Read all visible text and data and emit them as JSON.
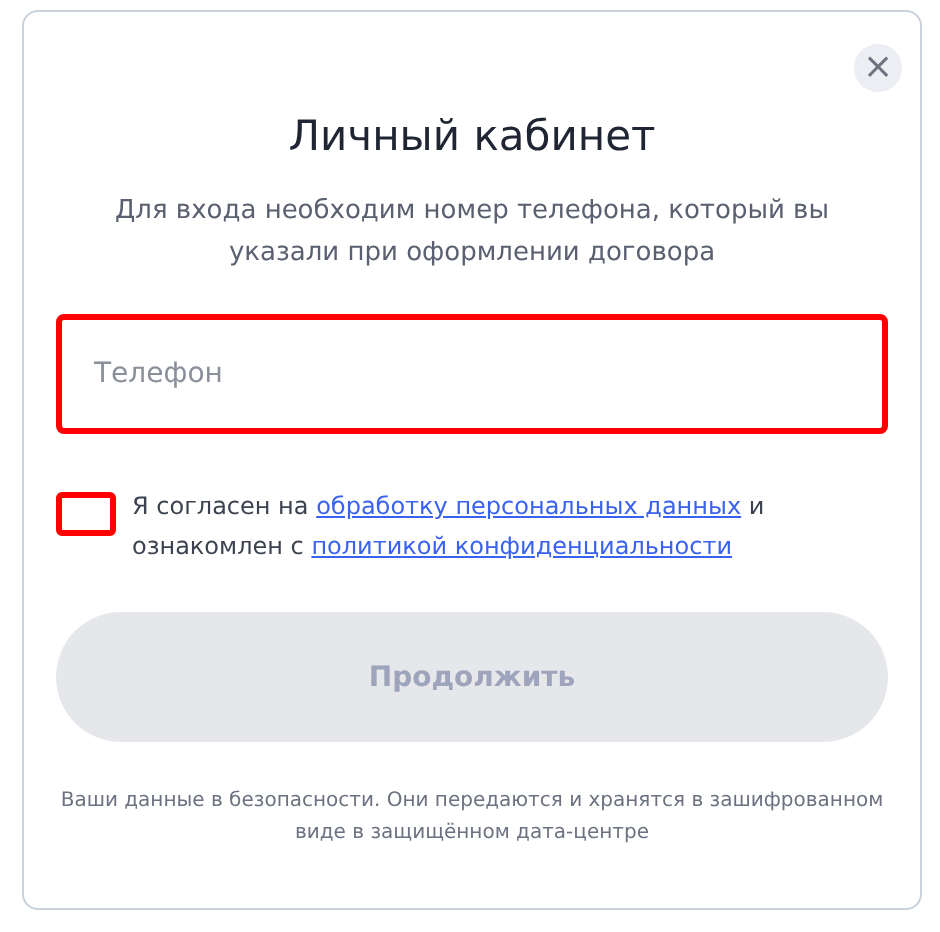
{
  "dialog": {
    "title": "Личный кабинет",
    "subtitle": "Для входа необходим номер телефона, который вы указали при оформлении договора",
    "close": "×"
  },
  "phone_field": {
    "placeholder": "Телефон",
    "invalid": true
  },
  "consent": {
    "checked": false,
    "invalid": true,
    "parts": [
      {
        "kind": "text",
        "text": "Я согласен на "
      },
      {
        "kind": "link",
        "text": "обработку персональных данных"
      },
      {
        "kind": "text",
        "text": " и ознакомлен с "
      },
      {
        "kind": "link",
        "text": "политикой конфиденциальности"
      }
    ]
  },
  "submit_button": {
    "label": "Продолжить",
    "disabled": true
  },
  "footer_note": "Ваши данные в безопасности. Они передаются и хранятся в зашифрованном виде в защищённом дата-центре"
}
